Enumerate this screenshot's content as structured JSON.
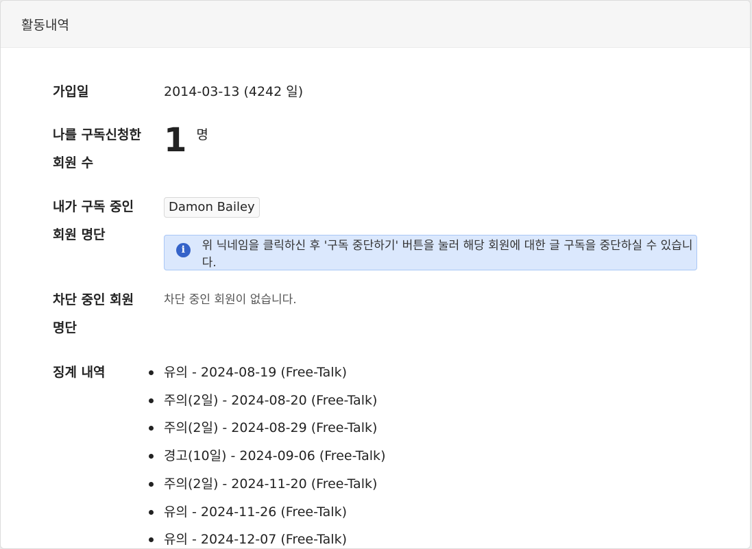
{
  "header": {
    "title": "활동내역"
  },
  "join": {
    "label": "가입일",
    "value": "2014-03-13 (4242 일)"
  },
  "subscribers": {
    "label_line1": "나를 구독신청한",
    "label_line2": "회원 수",
    "count": "1",
    "unit": "명"
  },
  "subscribing": {
    "label_line1": "내가 구독 중인",
    "label_line2": "회원 명단",
    "members": [
      "Damon Bailey"
    ],
    "info": "위 닉네임을 클릭하신 후 '구독 중단하기' 버튼을 눌러 해당 회원에 대한 글 구독을 중단하실 수 있습니다."
  },
  "blocked": {
    "label_line1": "차단 중인 회원",
    "label_line2": "명단",
    "empty_text": "차단 중인 회원이 없습니다."
  },
  "discipline": {
    "label": "징계 내역",
    "items": [
      "유의 - 2024-08-19 (Free-Talk)",
      "주의(2일) - 2024-08-20 (Free-Talk)",
      "주의(2일) - 2024-08-29 (Free-Talk)",
      "경고(10일) - 2024-09-06 (Free-Talk)",
      "주의(2일) - 2024-11-20 (Free-Talk)",
      "유의 - 2024-11-26 (Free-Talk)",
      "유의 - 2024-12-07 (Free-Talk)"
    ]
  },
  "colors": {
    "info_bg": "#dbe8fd",
    "info_border": "#a9c7f5",
    "info_icon": "#3563c9"
  }
}
